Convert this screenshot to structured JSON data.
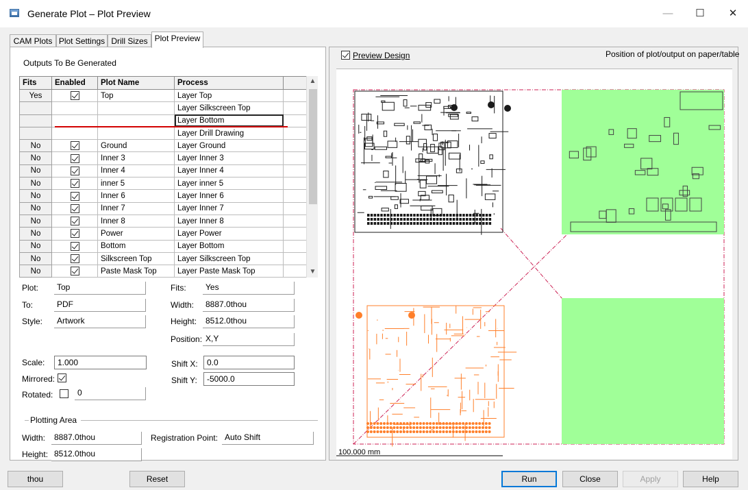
{
  "window": {
    "title": "Generate Plot – Plot Preview",
    "minimize_glyph": "—",
    "maximize_glyph": "☐",
    "close_glyph": "✕"
  },
  "tabs": [
    {
      "label": "CAM Plots"
    },
    {
      "label": "Plot Settings"
    },
    {
      "label": "Drill Sizes"
    },
    {
      "label": "Plot Preview"
    }
  ],
  "outputs": {
    "heading": "Outputs To Be Generated",
    "columns": [
      "Fits",
      "Enabled",
      "Plot Name",
      "Process"
    ],
    "rows": [
      {
        "fits": "Yes",
        "enabled": true,
        "plot_name": "Top",
        "process": "Layer Top"
      },
      {
        "fits": "",
        "enabled": null,
        "plot_name": "",
        "process": "Layer Silkscreen Top"
      },
      {
        "fits": "",
        "enabled": null,
        "plot_name": "",
        "process": "Layer Bottom"
      },
      {
        "fits": "",
        "enabled": null,
        "plot_name": "",
        "process": "Layer Drill Drawing"
      },
      {
        "fits": "No",
        "enabled": true,
        "plot_name": "Ground",
        "process": "Layer Ground"
      },
      {
        "fits": "No",
        "enabled": true,
        "plot_name": "Inner 3",
        "process": "Layer Inner 3"
      },
      {
        "fits": "No",
        "enabled": true,
        "plot_name": "Inner 4",
        "process": "Layer Inner 4"
      },
      {
        "fits": "No",
        "enabled": true,
        "plot_name": "inner 5",
        "process": "Layer inner 5"
      },
      {
        "fits": "No",
        "enabled": true,
        "plot_name": "Inner 6",
        "process": "Layer Inner 6"
      },
      {
        "fits": "No",
        "enabled": true,
        "plot_name": "Inner 7",
        "process": "Layer Inner 7"
      },
      {
        "fits": "No",
        "enabled": true,
        "plot_name": "Inner 8",
        "process": "Layer Inner 8"
      },
      {
        "fits": "No",
        "enabled": true,
        "plot_name": "Power",
        "process": "Layer Power"
      },
      {
        "fits": "No",
        "enabled": true,
        "plot_name": "Bottom",
        "process": "Layer Bottom"
      },
      {
        "fits": "No",
        "enabled": true,
        "plot_name": "Silkscreen Top",
        "process": "Layer Silkscreen Top"
      },
      {
        "fits": "No",
        "enabled": true,
        "plot_name": "Paste Mask Top",
        "process": "Layer Paste Mask Top"
      }
    ],
    "selected_row": 2,
    "scroll_up_glyph": "▲",
    "scroll_down_glyph": "▼"
  },
  "details": {
    "plot_label": "Plot:",
    "plot_value": "Top",
    "to_label": "To:",
    "to_value": "PDF",
    "style_label": "Style:",
    "style_value": "Artwork",
    "fits_label": "Fits:",
    "fits_value": "Yes",
    "width_label": "Width:",
    "width_value": "8887.0thou",
    "height_label": "Height:",
    "height_value": "8512.0thou",
    "position_label": "Position:",
    "position_value": "X,Y",
    "scale_label": "Scale:",
    "scale_value": "1.000",
    "mirrored_label": "Mirrored:",
    "mirrored": true,
    "rotated_label": "Rotated:",
    "rotated": false,
    "rotated_value": "0",
    "shiftx_label": "Shift X:",
    "shiftx_value": "0.0",
    "shifty_label": "Shift Y:",
    "shifty_value": "-5000.0"
  },
  "plotting_area": {
    "heading": "Plotting Area",
    "width_label": "Width:",
    "width_value": "8887.0thou",
    "height_label": "Height:",
    "height_value": "8512.0thou",
    "registration_label": "Registration Point:",
    "registration_value": "Auto Shift"
  },
  "preview": {
    "checkbox_label": "Preview Design",
    "checked": true,
    "position_label": "Position of plot/output on paper/table",
    "scale_label": "100.000 mm",
    "colors": {
      "top_layer": "#1a1a1a",
      "bottom_layer": "#ff7f2a",
      "plane_fill": "#a0ff98",
      "border": "#cc2255"
    }
  },
  "buttons": {
    "units": "thou",
    "reset": "Reset",
    "run": "Run",
    "close": "Close",
    "apply": "Apply",
    "help": "Help"
  }
}
